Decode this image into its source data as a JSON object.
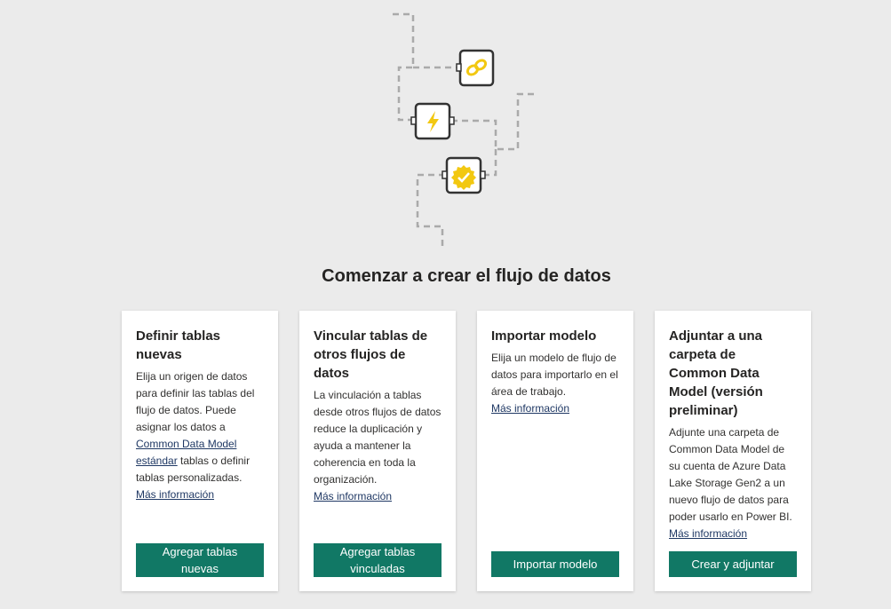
{
  "page": {
    "heading": "Comenzar a crear el flujo de datos"
  },
  "illustration": {
    "icons": [
      "link-icon",
      "lightning-icon",
      "verified-badge-icon"
    ],
    "accent_color": "#f2c811",
    "line_color": "#aaaaaa"
  },
  "cards": [
    {
      "title": "Definir tablas nuevas",
      "desc_before": "Elija un origen de datos para definir las tablas del flujo de datos. Puede asignar los datos a ",
      "desc_link": "Common Data Model estándar",
      "desc_after": " tablas o definir tablas personalizadas.",
      "more": "Más información",
      "button": "Agregar tablas nuevas"
    },
    {
      "title": "Vincular tablas de otros flujos de datos",
      "desc": "La vinculación a tablas desde otros flujos de datos reduce la duplicación y ayuda a mantener la coherencia en toda la organización.",
      "more": "Más información",
      "button": "Agregar tablas vinculadas"
    },
    {
      "title": "Importar modelo",
      "desc": "Elija un modelo de flujo de datos para importarlo en el área de trabajo.",
      "more": "Más información",
      "button": "Importar modelo"
    },
    {
      "title": "Adjuntar a una carpeta de Common Data Model (versión preliminar)",
      "desc": "Adjunte una carpeta de Common Data Model de su cuenta de Azure Data Lake Storage Gen2 a un nuevo flujo de datos para poder usarlo en Power BI.",
      "more": "Más información",
      "button": "Crear y adjuntar"
    }
  ],
  "colors": {
    "button_bg": "#117865",
    "link": "#1f3864",
    "page_bg": "#ebebeb"
  }
}
